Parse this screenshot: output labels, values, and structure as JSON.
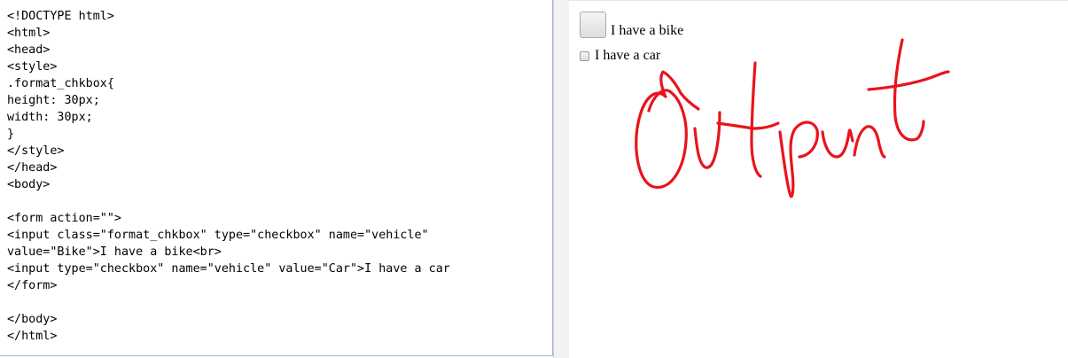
{
  "editor": {
    "lines": [
      "<!DOCTYPE html>",
      "<html>",
      "<head>",
      "<style>",
      ".format_chkbox{",
      "height: 30px;",
      "width: 30px;",
      "}",
      "</style>",
      "</head>",
      "<body>",
      "",
      "<form action=\"\">",
      "<input class=\"format_chkbox\" type=\"checkbox\" name=\"vehicle\"",
      "value=\"Bike\">I have a bike<br>",
      "<input type=\"checkbox\" name=\"vehicle\" value=\"Car\">I have a car",
      "</form>",
      "",
      "</body>",
      "</html>"
    ]
  },
  "preview": {
    "checkbox_bike_label": "I have a bike",
    "checkbox_car_label": "I have a car",
    "checkbox_bike_checked": false,
    "checkbox_car_checked": false
  },
  "colors": {
    "annotation_stroke": "#e8141c",
    "editor_border": "#9ebadf"
  }
}
